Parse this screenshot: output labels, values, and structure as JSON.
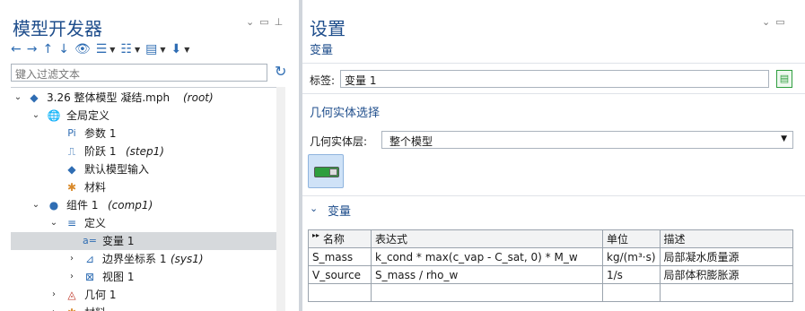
{
  "left_panel": {
    "title": "模型开发器",
    "filter_placeholder": "键入过滤文本",
    "tree": [
      {
        "label": "3.26   整体模型   凝结.mph",
        "tag": "(root)",
        "icon": "model-icon"
      },
      {
        "label": "全局定义",
        "tag": "",
        "icon": "globe-icon"
      },
      {
        "label": "参数 1",
        "tag": "",
        "icon": "parameters-icon"
      },
      {
        "label": "阶跃 1",
        "tag": "(step1)",
        "icon": "step-function-icon"
      },
      {
        "label": "默认模型输入",
        "tag": "",
        "icon": "model-input-icon"
      },
      {
        "label": "材料",
        "tag": "",
        "icon": "materials-icon"
      },
      {
        "label": "组件 1",
        "tag": "(comp1)",
        "icon": "component-icon"
      },
      {
        "label": "定义",
        "tag": "",
        "icon": "definitions-icon"
      },
      {
        "label": "变量 1",
        "tag": "",
        "icon": "variables-icon"
      },
      {
        "label": "边界坐标系 1",
        "tag": "(sys1)",
        "icon": "coordinate-system-icon"
      },
      {
        "label": "视图 1",
        "tag": "",
        "icon": "view-icon"
      },
      {
        "label": "几何 1",
        "tag": "",
        "icon": "geometry-icon"
      },
      {
        "label": "材料",
        "tag": "",
        "icon": "materials-icon"
      }
    ]
  },
  "right_panel": {
    "title": "设置",
    "subtitle": "变量",
    "label_caption": "标签:",
    "label_value": "变量 1",
    "geom_section": "几何实体选择",
    "geom_level_caption": "几何实体层:",
    "geom_level_value": "整个模型",
    "variables_section": "变量",
    "table": {
      "headers": [
        "名称",
        "表达式",
        "单位",
        "描述"
      ],
      "rows": [
        [
          "S_mass",
          "k_cond * max(c_vap - C_sat, 0) * M_w",
          "kg/(m³·s)",
          "局部凝水质量源"
        ],
        [
          "V_source",
          "S_mass / rho_w",
          "1/s",
          "局部体积膨胀源"
        ]
      ]
    }
  },
  "colors": {
    "accent": "#1f4e8c",
    "selection": "#d6d9dc"
  }
}
